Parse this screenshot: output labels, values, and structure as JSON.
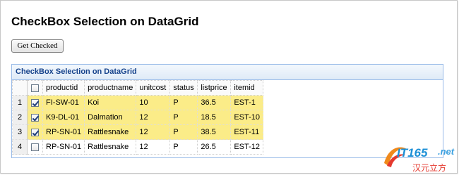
{
  "page": {
    "title": "CheckBox Selection on DataGrid",
    "button_label": "Get Checked"
  },
  "panel": {
    "title": "CheckBox Selection on DataGrid"
  },
  "grid": {
    "columns": [
      "productid",
      "productname",
      "unitcost",
      "status",
      "listprice",
      "itemid"
    ],
    "rows": [
      {
        "rownum": "1",
        "checked": true,
        "cells": [
          "FI-SW-01",
          "Koi",
          "10",
          "P",
          "36.5",
          "EST-1"
        ]
      },
      {
        "rownum": "2",
        "checked": true,
        "cells": [
          "K9-DL-01",
          "Dalmation",
          "12",
          "P",
          "18.5",
          "EST-10"
        ]
      },
      {
        "rownum": "3",
        "checked": true,
        "cells": [
          "RP-SN-01",
          "Rattlesnake",
          "12",
          "P",
          "38.5",
          "EST-11"
        ]
      },
      {
        "rownum": "4",
        "checked": false,
        "cells": [
          "RP-SN-01",
          "Rattlesnake",
          "12",
          "P",
          "26.5",
          "EST-12"
        ]
      }
    ]
  },
  "watermark": {
    "logo": "IT165",
    "suffix": ".net",
    "chinese": "汉元立方"
  },
  "colors": {
    "selected_row": "#fbec88",
    "panel_title": "#15428b",
    "panel_border": "#99bbe8"
  }
}
